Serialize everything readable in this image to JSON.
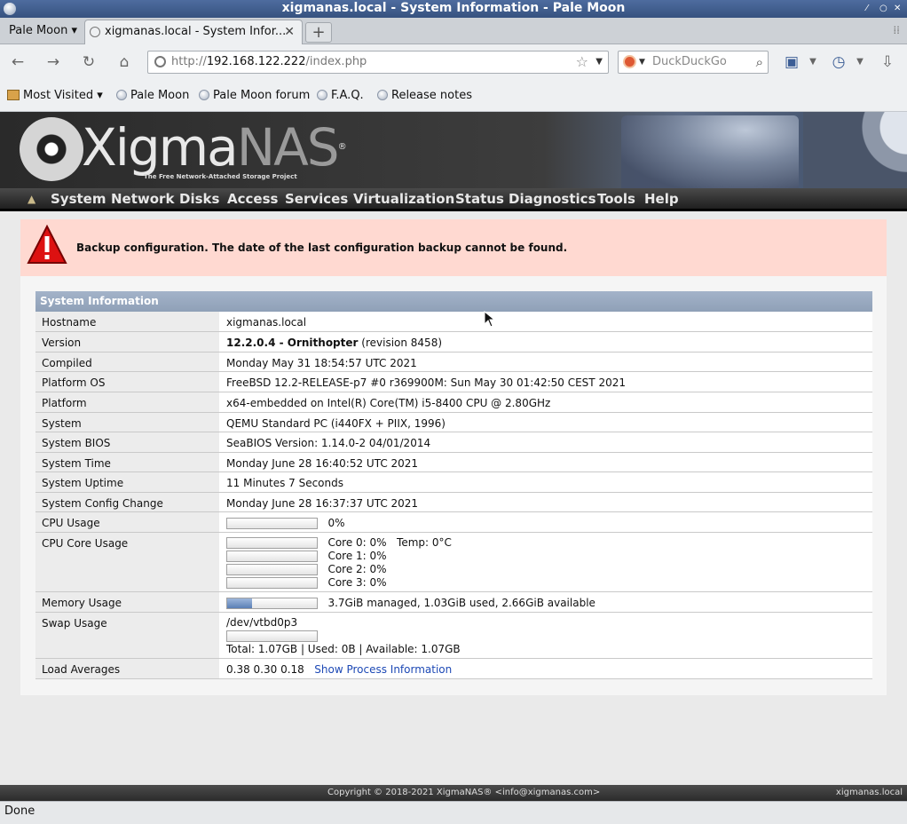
{
  "window": {
    "title": "xigmanas.local - System Information - Pale Moon"
  },
  "tabbar": {
    "menu_label": "Pale Moon",
    "tab_label": "xigmanas.local - System Infor...",
    "new_tab": "+"
  },
  "navbar": {
    "url_prefix": "http://",
    "url_host": "192.168.122.222",
    "url_path": "/index.php",
    "search_placeholder": "DuckDuckGo"
  },
  "bookmarks": [
    "Most Visited",
    "Pale Moon",
    "Pale Moon forum",
    "F.A.Q.",
    "Release notes"
  ],
  "header": {
    "logo_main": "Xigma",
    "logo_nas": "NAS",
    "logo_reg": "®",
    "logo_sub": "The Free Network-Attached Storage Project"
  },
  "mainnav": [
    "System",
    "Network",
    "Disks",
    "Access",
    "Services",
    "Virtualization",
    "Status",
    "Diagnostics",
    "Tools",
    "Help"
  ],
  "alert": {
    "text": "Backup configuration. The date of the last configuration backup cannot be found."
  },
  "sysinfo": {
    "title": "System Information",
    "hostname": {
      "label": "Hostname",
      "value": "xigmanas.local"
    },
    "version": {
      "label": "Version",
      "bold": "12.2.0.4 - Ornithopter",
      "rest": " (revision 8458)"
    },
    "compiled": {
      "label": "Compiled",
      "value": "Monday May 31 18:54:57 UTC 2021"
    },
    "platform_os": {
      "label": "Platform OS",
      "value": "FreeBSD 12.2-RELEASE-p7 #0 r369900M: Sun May 30 01:42:50 CEST 2021"
    },
    "platform": {
      "label": "Platform",
      "value": "x64-embedded on Intel(R) Core(TM) i5-8400 CPU @ 2.80GHz"
    },
    "system": {
      "label": "System",
      "value": "QEMU Standard PC (i440FX + PIIX, 1996)"
    },
    "bios": {
      "label": "System BIOS",
      "value": "SeaBIOS Version: 1.14.0-2 04/01/2014"
    },
    "time": {
      "label": "System Time",
      "value": "Monday June 28 16:40:52 UTC 2021"
    },
    "uptime": {
      "label": "System Uptime",
      "value": "11 Minutes 7 Seconds"
    },
    "config_change": {
      "label": "System Config Change",
      "value": "Monday June 28 16:37:37 UTC 2021"
    },
    "cpu_usage": {
      "label": "CPU Usage",
      "value": "0%",
      "fill": 0
    },
    "cpu_core": {
      "label": "CPU Core Usage",
      "cores": [
        "Core 0: 0%",
        "Core 1: 0%",
        "Core 2: 0%",
        "Core 3: 0%"
      ],
      "temp": "Temp: 0°C"
    },
    "memory": {
      "label": "Memory Usage",
      "value": "3.7GiB managed, 1.03GiB used, 2.66GiB available",
      "fill": 0.28
    },
    "swap": {
      "label": "Swap Usage",
      "device": "/dev/vtbd0p3",
      "summary": "Total: 1.07GB | Used: 0B | Available: 1.07GB",
      "fill": 0
    },
    "load": {
      "label": "Load Averages",
      "value": "0.38 0.30 0.18",
      "link": "Show Process Information"
    }
  },
  "footer": {
    "copyright": "Copyright © 2018-2021 XigmaNAS® <info@xigmanas.com>",
    "host": "xigmanas.local"
  },
  "status": {
    "text": "Done"
  }
}
